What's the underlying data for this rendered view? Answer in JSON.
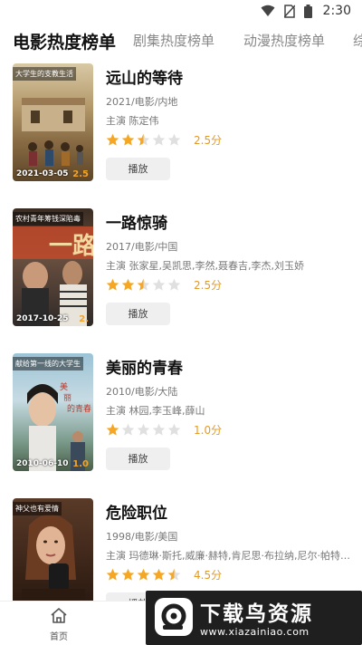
{
  "status_bar": {
    "time": "2:30"
  },
  "tabs": [
    {
      "label": "电影热度榜单",
      "active": true
    },
    {
      "label": "剧集热度榜单",
      "active": false
    },
    {
      "label": "动漫热度榜单",
      "active": false
    },
    {
      "label": "综",
      "active": false
    }
  ],
  "movies": [
    {
      "title": "远山的等待",
      "meta": "2021/电影/内地",
      "cast": "主演 陈定伟",
      "stars": 2.5,
      "rating": "2.5分",
      "play_label": "播放",
      "poster": {
        "tag": "大学生的支教生活",
        "date": "2021-03-05",
        "score": "2.5"
      }
    },
    {
      "title": "一路惊骑",
      "meta": "2017/电影/中国",
      "cast": "主演 张家星,吴凯思,李然,聂春吉,李杰,刘玉娇",
      "stars": 2.5,
      "rating": "2.5分",
      "play_label": "播放",
      "poster": {
        "tag": "农村青年筹钱深陷毒",
        "date": "2017-10-25",
        "score": "2."
      }
    },
    {
      "title": "美丽的青春",
      "meta": "2010/电影/大陆",
      "cast": "主演 林园,李玉峰,薛山",
      "stars": 1.0,
      "rating": "1.0分",
      "play_label": "播放",
      "poster": {
        "tag": "献给第一线的大学生",
        "date": "2010-06-10",
        "score": "1.0"
      }
    },
    {
      "title": "危险职位",
      "meta": "1998/电影/美国",
      "cast": "主演 玛德琳·斯托,威廉·赫特,肯尼思·布拉纳,尼尔·帕特里...",
      "stars": 4.5,
      "rating": "4.5分",
      "play_label": "播放",
      "poster": {
        "tag": "神父也有爱情",
        "date": "",
        "score": ""
      }
    }
  ],
  "bottom_nav": {
    "home_label": "首页"
  },
  "watermark": {
    "title": "下载鸟资源",
    "url": "www.xiazainiao.com"
  },
  "colors": {
    "star_on": "#f5a623",
    "star_off": "#e0e0e0",
    "rating": "#e69a21"
  }
}
